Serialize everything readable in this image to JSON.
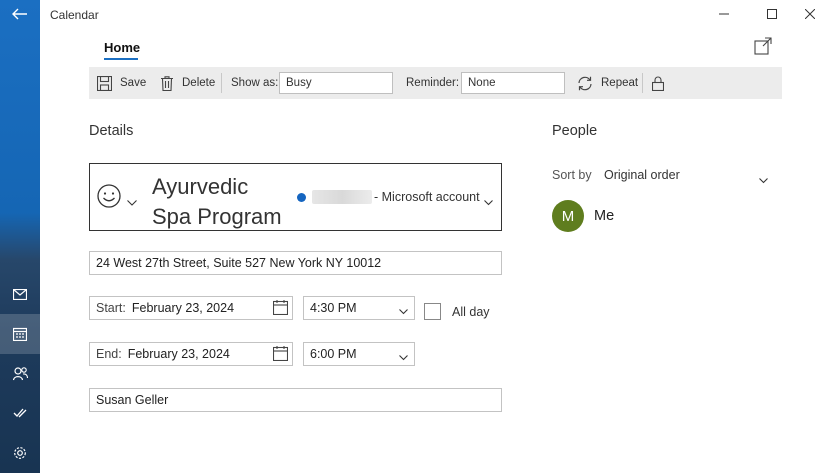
{
  "window": {
    "title": "Calendar"
  },
  "tabs": {
    "home": "Home"
  },
  "toolbar": {
    "save_label": "Save",
    "delete_label": "Delete",
    "show_as_label": "Show as:",
    "show_as_value": "Busy",
    "reminder_label": "Reminder:",
    "reminder_value": "None",
    "repeat_label": "Repeat"
  },
  "details": {
    "heading": "Details",
    "event_title_line1": "Ayurvedic",
    "event_title_line2": "Spa Program",
    "account_label": "- Microsoft account",
    "account_color": "#1565c0",
    "location": "24 West 27th Street, Suite 527 New York NY 10012",
    "start_label": "Start:",
    "start_date": "February 23, 2024",
    "start_time": "4:30 PM",
    "all_day_label": "All day",
    "end_label": "End:",
    "end_date": "February 23, 2024",
    "end_time": "6:00 PM",
    "attendee": "Susan Geller"
  },
  "people": {
    "heading": "People",
    "sort_label": "Sort by",
    "sort_value": "Original order",
    "avatar_initial": "M",
    "avatar_color": "#5f7d1e",
    "person_name": "Me"
  },
  "icons": [
    "back-arrow-icon",
    "mail-icon",
    "calendar-icon",
    "people-icon",
    "todo-icon",
    "settings-icon",
    "save-icon",
    "delete-icon",
    "repeat-icon",
    "lock-icon",
    "popout-icon",
    "smiley-icon",
    "calendar-picker-icon",
    "chevron-down-icon"
  ]
}
